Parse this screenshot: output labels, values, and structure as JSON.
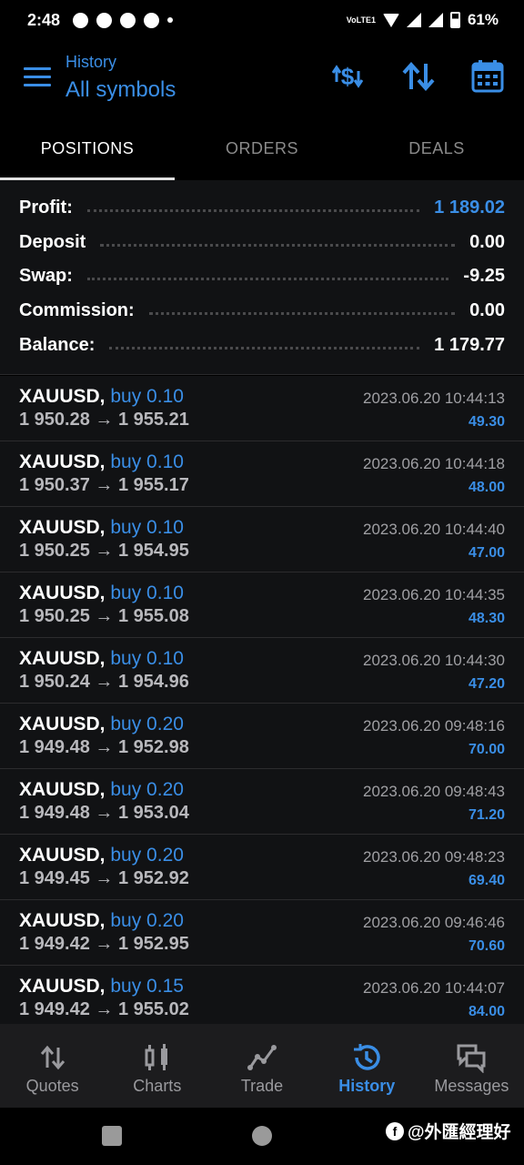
{
  "status_bar": {
    "time": "2:48",
    "network": "VoLTE1",
    "battery": "61%"
  },
  "header": {
    "subtitle": "History",
    "title": "All symbols",
    "icons": [
      "currency-exchange-icon",
      "sort-icon",
      "calendar-icon"
    ]
  },
  "tabs": [
    {
      "label": "POSITIONS",
      "active": true
    },
    {
      "label": "ORDERS",
      "active": false
    },
    {
      "label": "DEALS",
      "active": false
    }
  ],
  "summary": [
    {
      "label": "Profit:",
      "value": "1 189.02"
    },
    {
      "label": "Deposit",
      "value": "0.00"
    },
    {
      "label": "Swap:",
      "value": "-9.25"
    },
    {
      "label": "Commission:",
      "value": "0.00"
    },
    {
      "label": "Balance:",
      "value": "1 179.77"
    }
  ],
  "positions": [
    {
      "symbol": "XAUUSD,",
      "direction": "buy 0.10",
      "open": "1 950.28",
      "close": "1 955.21",
      "time": "2023.06.20 10:44:13",
      "profit": "49.30"
    },
    {
      "symbol": "XAUUSD,",
      "direction": "buy 0.10",
      "open": "1 950.37",
      "close": "1 955.17",
      "time": "2023.06.20 10:44:18",
      "profit": "48.00"
    },
    {
      "symbol": "XAUUSD,",
      "direction": "buy 0.10",
      "open": "1 950.25",
      "close": "1 954.95",
      "time": "2023.06.20 10:44:40",
      "profit": "47.00"
    },
    {
      "symbol": "XAUUSD,",
      "direction": "buy 0.10",
      "open": "1 950.25",
      "close": "1 955.08",
      "time": "2023.06.20 10:44:35",
      "profit": "48.30"
    },
    {
      "symbol": "XAUUSD,",
      "direction": "buy 0.10",
      "open": "1 950.24",
      "close": "1 954.96",
      "time": "2023.06.20 10:44:30",
      "profit": "47.20"
    },
    {
      "symbol": "XAUUSD,",
      "direction": "buy 0.20",
      "open": "1 949.48",
      "close": "1 952.98",
      "time": "2023.06.20 09:48:16",
      "profit": "70.00"
    },
    {
      "symbol": "XAUUSD,",
      "direction": "buy 0.20",
      "open": "1 949.48",
      "close": "1 953.04",
      "time": "2023.06.20 09:48:43",
      "profit": "71.20"
    },
    {
      "symbol": "XAUUSD,",
      "direction": "buy 0.20",
      "open": "1 949.45",
      "close": "1 952.92",
      "time": "2023.06.20 09:48:23",
      "profit": "69.40"
    },
    {
      "symbol": "XAUUSD,",
      "direction": "buy 0.20",
      "open": "1 949.42",
      "close": "1 952.95",
      "time": "2023.06.20 09:46:46",
      "profit": "70.60"
    },
    {
      "symbol": "XAUUSD,",
      "direction": "buy 0.15",
      "open": "1 949.42",
      "close": "1 955.02",
      "time": "2023.06.20 10:44:07",
      "profit": "84.00"
    }
  ],
  "arrow": "→",
  "bottom_nav": [
    {
      "label": "Quotes",
      "icon": "quotes-icon",
      "active": false
    },
    {
      "label": "Charts",
      "icon": "charts-icon",
      "active": false
    },
    {
      "label": "Trade",
      "icon": "trade-icon",
      "active": false
    },
    {
      "label": "History",
      "icon": "history-icon",
      "active": true
    },
    {
      "label": "Messages",
      "icon": "messages-icon",
      "active": false
    }
  ],
  "watermark": "@外匯經理好",
  "colors": {
    "accent": "#3a8ee6",
    "background": "#111214",
    "header_background": "#000000"
  }
}
